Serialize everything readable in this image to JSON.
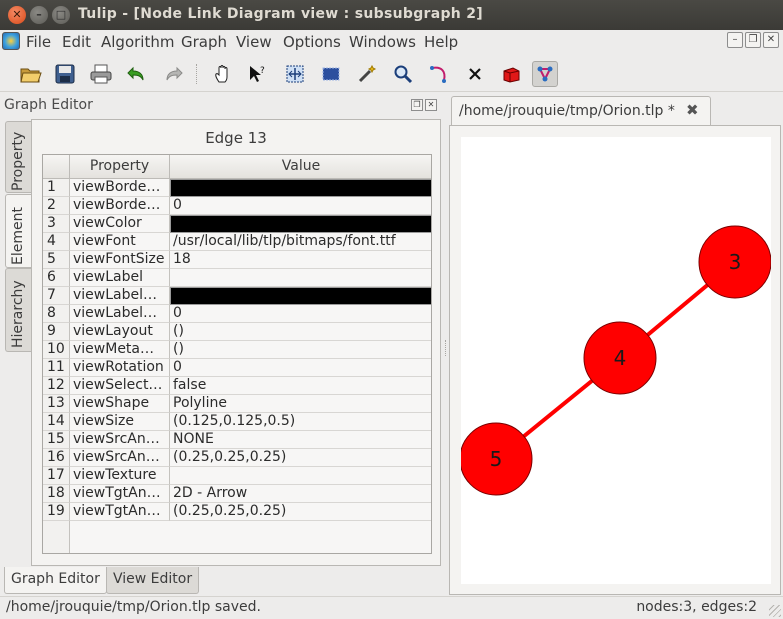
{
  "window": {
    "title": "Tulip - [Node Link Diagram view : subsubgraph 2]",
    "close_glyph": "✕",
    "min_glyph": "–",
    "max_glyph": "□"
  },
  "menu": {
    "items": [
      "File",
      "Edit",
      "Algorithm",
      "Graph",
      "View",
      "Options",
      "Windows",
      "Help"
    ]
  },
  "toolbar": {
    "icons": [
      "open-folder-icon",
      "save-icon",
      "print-icon",
      "undo-icon",
      "redo-icon",
      "pan-hand-icon",
      "select-pointer-icon",
      "zoom-box-icon",
      "rectangle-select-icon",
      "magic-wand-icon",
      "magnifier-icon",
      "bend-edge-icon",
      "delete-x-icon",
      "add-node-cube-icon",
      "add-edge-icon"
    ]
  },
  "graph_editor": {
    "title": "Graph Editor",
    "side_tabs": [
      "Property",
      "Element",
      "Hierarchy"
    ],
    "active_side_tab": "Element",
    "element_title": "Edge 13",
    "columns": [
      "Property",
      "Value"
    ],
    "rows": [
      {
        "n": "1",
        "prop": "viewBorde…",
        "value": "",
        "swatch": "#000000"
      },
      {
        "n": "2",
        "prop": "viewBorde…",
        "value": "0"
      },
      {
        "n": "3",
        "prop": "viewColor",
        "value": "",
        "swatch": "#000000"
      },
      {
        "n": "4",
        "prop": "viewFont",
        "value": "/usr/local/lib/tlp/bitmaps/font.ttf"
      },
      {
        "n": "5",
        "prop": "viewFontSize",
        "value": "18"
      },
      {
        "n": "6",
        "prop": "viewLabel",
        "value": ""
      },
      {
        "n": "7",
        "prop": "viewLabel…",
        "value": "",
        "swatch": "#000000"
      },
      {
        "n": "8",
        "prop": "viewLabel…",
        "value": "0"
      },
      {
        "n": "9",
        "prop": "viewLayout",
        "value": "()"
      },
      {
        "n": "10",
        "prop": "viewMeta…",
        "value": "()"
      },
      {
        "n": "11",
        "prop": "viewRotation",
        "value": "0"
      },
      {
        "n": "12",
        "prop": "viewSelect…",
        "value": "false"
      },
      {
        "n": "13",
        "prop": "viewShape",
        "value": "Polyline"
      },
      {
        "n": "14",
        "prop": "viewSize",
        "value": "(0.125,0.125,0.5)"
      },
      {
        "n": "15",
        "prop": "viewSrcAn…",
        "value": "NONE"
      },
      {
        "n": "16",
        "prop": "viewSrcAn…",
        "value": "(0.25,0.25,0.25)"
      },
      {
        "n": "17",
        "prop": "viewTexture",
        "value": ""
      },
      {
        "n": "18",
        "prop": "viewTgtAn…",
        "value": "2D - Arrow"
      },
      {
        "n": "19",
        "prop": "viewTgtAn…",
        "value": "(0.25,0.25,0.25)"
      }
    ],
    "bottom_tabs": [
      "Graph Editor",
      "View Editor"
    ],
    "active_bottom_tab": "Graph Editor"
  },
  "document": {
    "tab_label": "/home/jrouquie/tmp/Orion.tlp *",
    "tab_close_glyph": "✖",
    "graph": {
      "node_color": "#ff0000",
      "edge_color": "#ff0000",
      "nodes": [
        {
          "label": "3"
        },
        {
          "label": "4"
        },
        {
          "label": "5"
        }
      ],
      "edges": [
        {
          "from": "5",
          "to": "4"
        },
        {
          "from": "4",
          "to": "3"
        }
      ]
    }
  },
  "status": {
    "message": "/home/jrouquie/tmp/Orion.tlp saved.",
    "counts": "nodes:3, edges:2"
  }
}
